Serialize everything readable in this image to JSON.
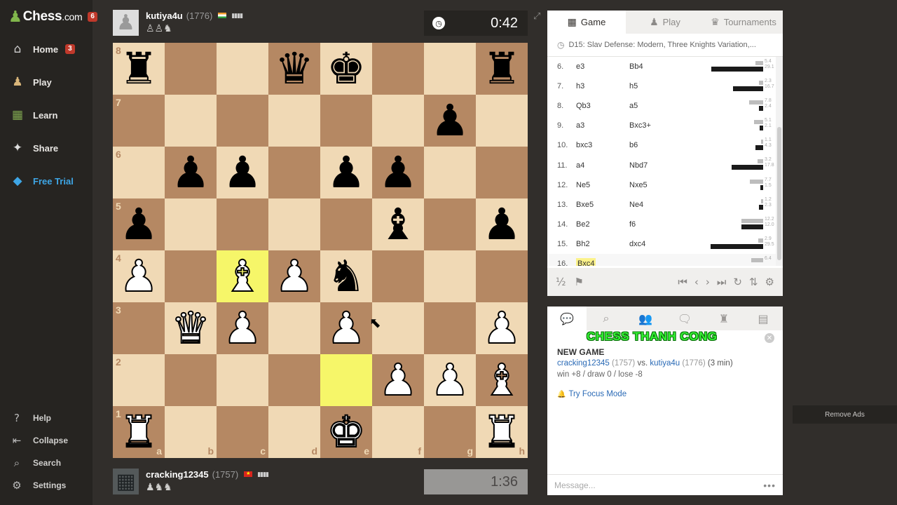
{
  "sidebar": {
    "logo_pawn": "♟",
    "logo_text": "Chess",
    "logo_suffix": ".com",
    "logo_badge": "6",
    "items": [
      {
        "label": "Home",
        "icon": "⌂",
        "badge": "3"
      },
      {
        "label": "Play",
        "icon": "♟"
      },
      {
        "label": "Learn",
        "icon": "▦"
      },
      {
        "label": "Share",
        "icon": "✦"
      },
      {
        "label": "Free Trial",
        "icon": "◆"
      }
    ],
    "bottom": [
      {
        "label": "Help",
        "icon": "?"
      },
      {
        "label": "Collapse",
        "icon": "⇤"
      },
      {
        "label": "Search",
        "icon": "⌕"
      },
      {
        "label": "Settings",
        "icon": "⚙"
      }
    ]
  },
  "top_player": {
    "name": "kutiya4u",
    "rating": "(1776)",
    "captured": "♙♙♞",
    "clock": "0:42"
  },
  "bottom_player": {
    "name": "cracking12345",
    "rating": "(1757)",
    "captured": "♟♞♞",
    "clock": "1:36"
  },
  "board": {
    "ranks": [
      "8",
      "7",
      "6",
      "5",
      "4",
      "3",
      "2",
      "1"
    ],
    "files": [
      "a",
      "b",
      "c",
      "d",
      "e",
      "f",
      "g",
      "h"
    ],
    "position": [
      [
        "bR",
        "",
        "",
        "bQ",
        "bK",
        "",
        "",
        "bR"
      ],
      [
        "",
        "",
        "",
        "",
        "",
        "",
        "bP",
        ""
      ],
      [
        "",
        "bP",
        "bP",
        "",
        "bP",
        "bP",
        "",
        ""
      ],
      [
        "bP",
        "",
        "",
        "",
        "",
        "bB",
        "",
        "bP"
      ],
      [
        "wP",
        "",
        "wB",
        "wP",
        "bN",
        "",
        "",
        ""
      ],
      [
        "",
        "wQ",
        "wP",
        "",
        "wP",
        "",
        "",
        "wP"
      ],
      [
        "",
        "",
        "",
        "",
        "",
        "wP",
        "wP",
        "wB"
      ],
      [
        "wR",
        "",
        "",
        "",
        "wK",
        "",
        "",
        "wR"
      ]
    ],
    "highlights": [
      "c4",
      "e2"
    ]
  },
  "panel": {
    "tabs": [
      {
        "label": "Game",
        "icon": "▦"
      },
      {
        "label": "Play",
        "icon": "♟"
      },
      {
        "label": "Tournaments",
        "icon": "♛"
      }
    ],
    "opening": "D15: Slav Defense: Modern, Three Knights Variation,...",
    "moves": [
      {
        "n": "6.",
        "w": "e3",
        "b": "Bb4",
        "t1": "5.4",
        "t2": "29.1",
        "ww": 11,
        "bw": 74
      },
      {
        "n": "7.",
        "w": "h3",
        "b": "h5",
        "t1": "2.3",
        "t2": "16.7",
        "ww": 6,
        "bw": 43
      },
      {
        "n": "8.",
        "w": "Qb3",
        "b": "a5",
        "t1": "7.8",
        "t2": "2.4",
        "ww": 20,
        "bw": 6
      },
      {
        "n": "9.",
        "w": "a3",
        "b": "Bxc3+",
        "t1": "5.1",
        "t2": "2.1",
        "ww": 13,
        "bw": 5
      },
      {
        "n": "10.",
        "w": "bxc3",
        "b": "b6",
        "t1": "1.1",
        "t2": "4.3",
        "ww": 3,
        "bw": 11
      },
      {
        "n": "11.",
        "w": "a4",
        "b": "Nbd7",
        "t1": "3.2",
        "t2": "17.8",
        "ww": 8,
        "bw": 45
      },
      {
        "n": "12.",
        "w": "Ne5",
        "b": "Nxe5",
        "t1": "7.7",
        "t2": "1.5",
        "ww": 19,
        "bw": 4
      },
      {
        "n": "13.",
        "w": "Bxe5",
        "b": "Ne4",
        "t1": "1.2",
        "t2": "2.3",
        "ww": 3,
        "bw": 6
      },
      {
        "n": "14.",
        "w": "Be2",
        "b": "f6",
        "t1": "12.2",
        "t2": "12.0",
        "ww": 31,
        "bw": 31
      },
      {
        "n": "15.",
        "w": "Bh2",
        "b": "dxc4",
        "t1": "2.9",
        "t2": "29.5",
        "ww": 7,
        "bw": 75
      },
      {
        "n": "16.",
        "w": "Bxc4",
        "b": "",
        "t1": "6.4",
        "t2": "",
        "ww": 17,
        "bw": 0
      }
    ],
    "controls_left": [
      "½",
      "⚑"
    ],
    "controls_nav": [
      "⏮",
      "‹",
      "›",
      "⏭",
      "↻",
      "⇅",
      "⚙"
    ]
  },
  "chat": {
    "tabs": [
      "💬",
      "⌕",
      "👥",
      "🗨",
      "♜",
      "▤"
    ],
    "watermark": "CHESS THANH CONG",
    "new_game": "NEW GAME",
    "white": "cracking12345",
    "white_rating": "(1757)",
    "vs": "vs.",
    "black": "kutiya4u",
    "black_rating": "(1776)",
    "time": "(3 min)",
    "score": "win +8 / draw 0 / lose -8",
    "focus": "Try Focus Mode",
    "placeholder": "Message...",
    "dots": "•••"
  },
  "remove_ads": "Remove Ads",
  "colors": {
    "light": "#f0d9b5",
    "dark": "#b58863",
    "highlight": "#f6f669",
    "accent": "#81b64c"
  }
}
